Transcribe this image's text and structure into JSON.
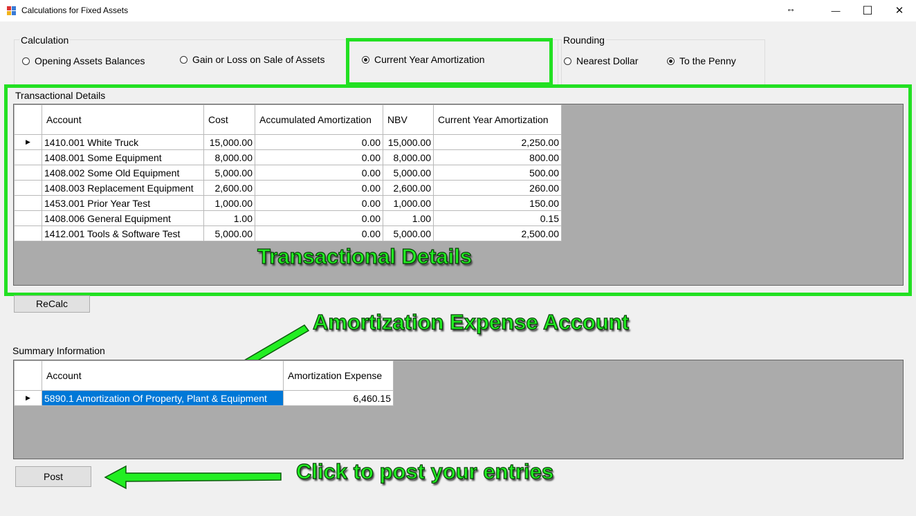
{
  "window": {
    "title": "Calculations for Fixed Assets",
    "buttons": {
      "resize": "↔",
      "minimize": "—",
      "maximize": "☐",
      "close": "✕"
    }
  },
  "calculation": {
    "label": "Calculation",
    "options": [
      {
        "label": "Opening Assets Balances",
        "checked": false
      },
      {
        "label": "Gain or Loss on Sale of Assets",
        "checked": false
      },
      {
        "label": "Current Year Amortization",
        "checked": true
      }
    ]
  },
  "rounding": {
    "label": "Rounding",
    "options": [
      {
        "label": "Nearest Dollar",
        "checked": false
      },
      {
        "label": "To the Penny",
        "checked": true
      }
    ]
  },
  "transactional": {
    "label": "Transactional Details",
    "columns": [
      "Account",
      "Cost",
      "Accumulated Amortization",
      "NBV",
      "Current Year Amortization"
    ],
    "rows": [
      {
        "account": "1410.001 White Truck",
        "cost": "15,000.00",
        "accum": "0.00",
        "nbv": "15,000.00",
        "current": "2,250.00"
      },
      {
        "account": "1408.001 Some Equipment",
        "cost": "8,000.00",
        "accum": "0.00",
        "nbv": "8,000.00",
        "current": "800.00"
      },
      {
        "account": "1408.002 Some Old Equipment",
        "cost": "5,000.00",
        "accum": "0.00",
        "nbv": "5,000.00",
        "current": "500.00"
      },
      {
        "account": "1408.003 Replacement Equipment",
        "cost": "2,600.00",
        "accum": "0.00",
        "nbv": "2,600.00",
        "current": "260.00"
      },
      {
        "account": "1453.001 Prior Year Test",
        "cost": "1,000.00",
        "accum": "0.00",
        "nbv": "1,000.00",
        "current": "150.00"
      },
      {
        "account": "1408.006 General Equipment",
        "cost": "1.00",
        "accum": "0.00",
        "nbv": "1.00",
        "current": "0.15"
      },
      {
        "account": "1412.001 Tools & Software Test",
        "cost": "5,000.00",
        "accum": "0.00",
        "nbv": "5,000.00",
        "current": "2,500.00"
      }
    ]
  },
  "recalc_label": "ReCalc",
  "summary": {
    "label": "Summary Information",
    "columns": [
      "Account",
      "Amortization Expense"
    ],
    "rows": [
      {
        "account": "5890.1 Amortization Of Property, Plant & Equipment",
        "expense": "6,460.15"
      }
    ]
  },
  "post_label": "Post",
  "annotations": {
    "transactional": "Transactional Details",
    "expense_account": "Amortization Expense Account",
    "post_hint": "Click to post your entries"
  },
  "colors": {
    "highlight": "#22e022",
    "selection": "#0078d7",
    "grid_background": "#ababab"
  }
}
